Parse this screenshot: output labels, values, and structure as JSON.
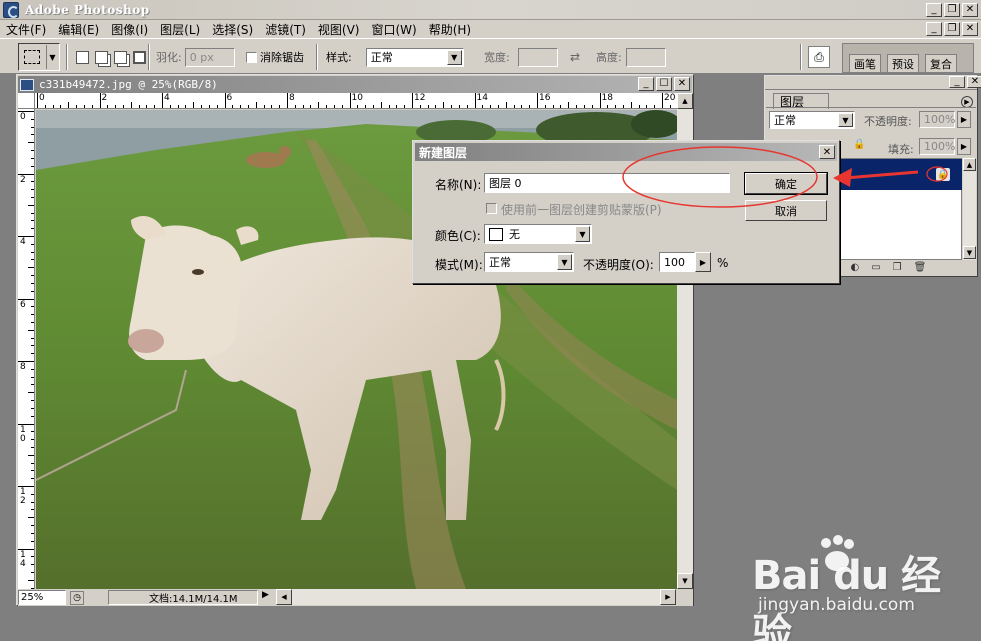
{
  "app": {
    "title": "Adobe Photoshop"
  },
  "menu": [
    "文件(F)",
    "编辑(E)",
    "图像(I)",
    "图层(L)",
    "选择(S)",
    "滤镜(T)",
    "视图(V)",
    "窗口(W)",
    "帮助(H)"
  ],
  "options": {
    "feather_label": "羽化:",
    "feather_value": "0 px",
    "antialias_label": "消除锯齿",
    "style_label": "样式:",
    "style_value": "正常",
    "width_label": "宽度:",
    "height_label": "高度:",
    "palette_tabs": [
      "画笔",
      "预设",
      "复合"
    ]
  },
  "document": {
    "title": "c331b49472.jpg @ 25%(RGB/8)",
    "ruler_h": [
      "0",
      "2",
      "4",
      "6",
      "8",
      "10",
      "12",
      "14",
      "16",
      "18",
      "20"
    ],
    "ruler_v": [
      "0",
      "2",
      "4",
      "6",
      "8",
      "10",
      "12",
      "14"
    ],
    "zoom": "25%",
    "doc_info": "文档:14.1M/14.1M"
  },
  "layers_panel": {
    "tab": "图层",
    "blend_mode": "正常",
    "opacity_label": "不透明度:",
    "opacity_value": "100%",
    "fill_label": "填充:",
    "fill_value": "100%"
  },
  "dialog": {
    "title": "新建图层",
    "name_label": "名称(N):",
    "name_value": "图层 0",
    "clip_label": "使用前一图层创建剪贴蒙版(P)",
    "color_label": "颜色(C):",
    "color_value": "无",
    "mode_label": "模式(M):",
    "mode_value": "正常",
    "opacity_label": "不透明度(O):",
    "opacity_value": "100",
    "opacity_unit": "%",
    "ok_label": "确定",
    "cancel_label": "取消"
  },
  "annotation": {
    "color": "#e8352f"
  },
  "watermark": {
    "brand": "Bai du 经验",
    "url": "jingyan.baidu.com"
  }
}
